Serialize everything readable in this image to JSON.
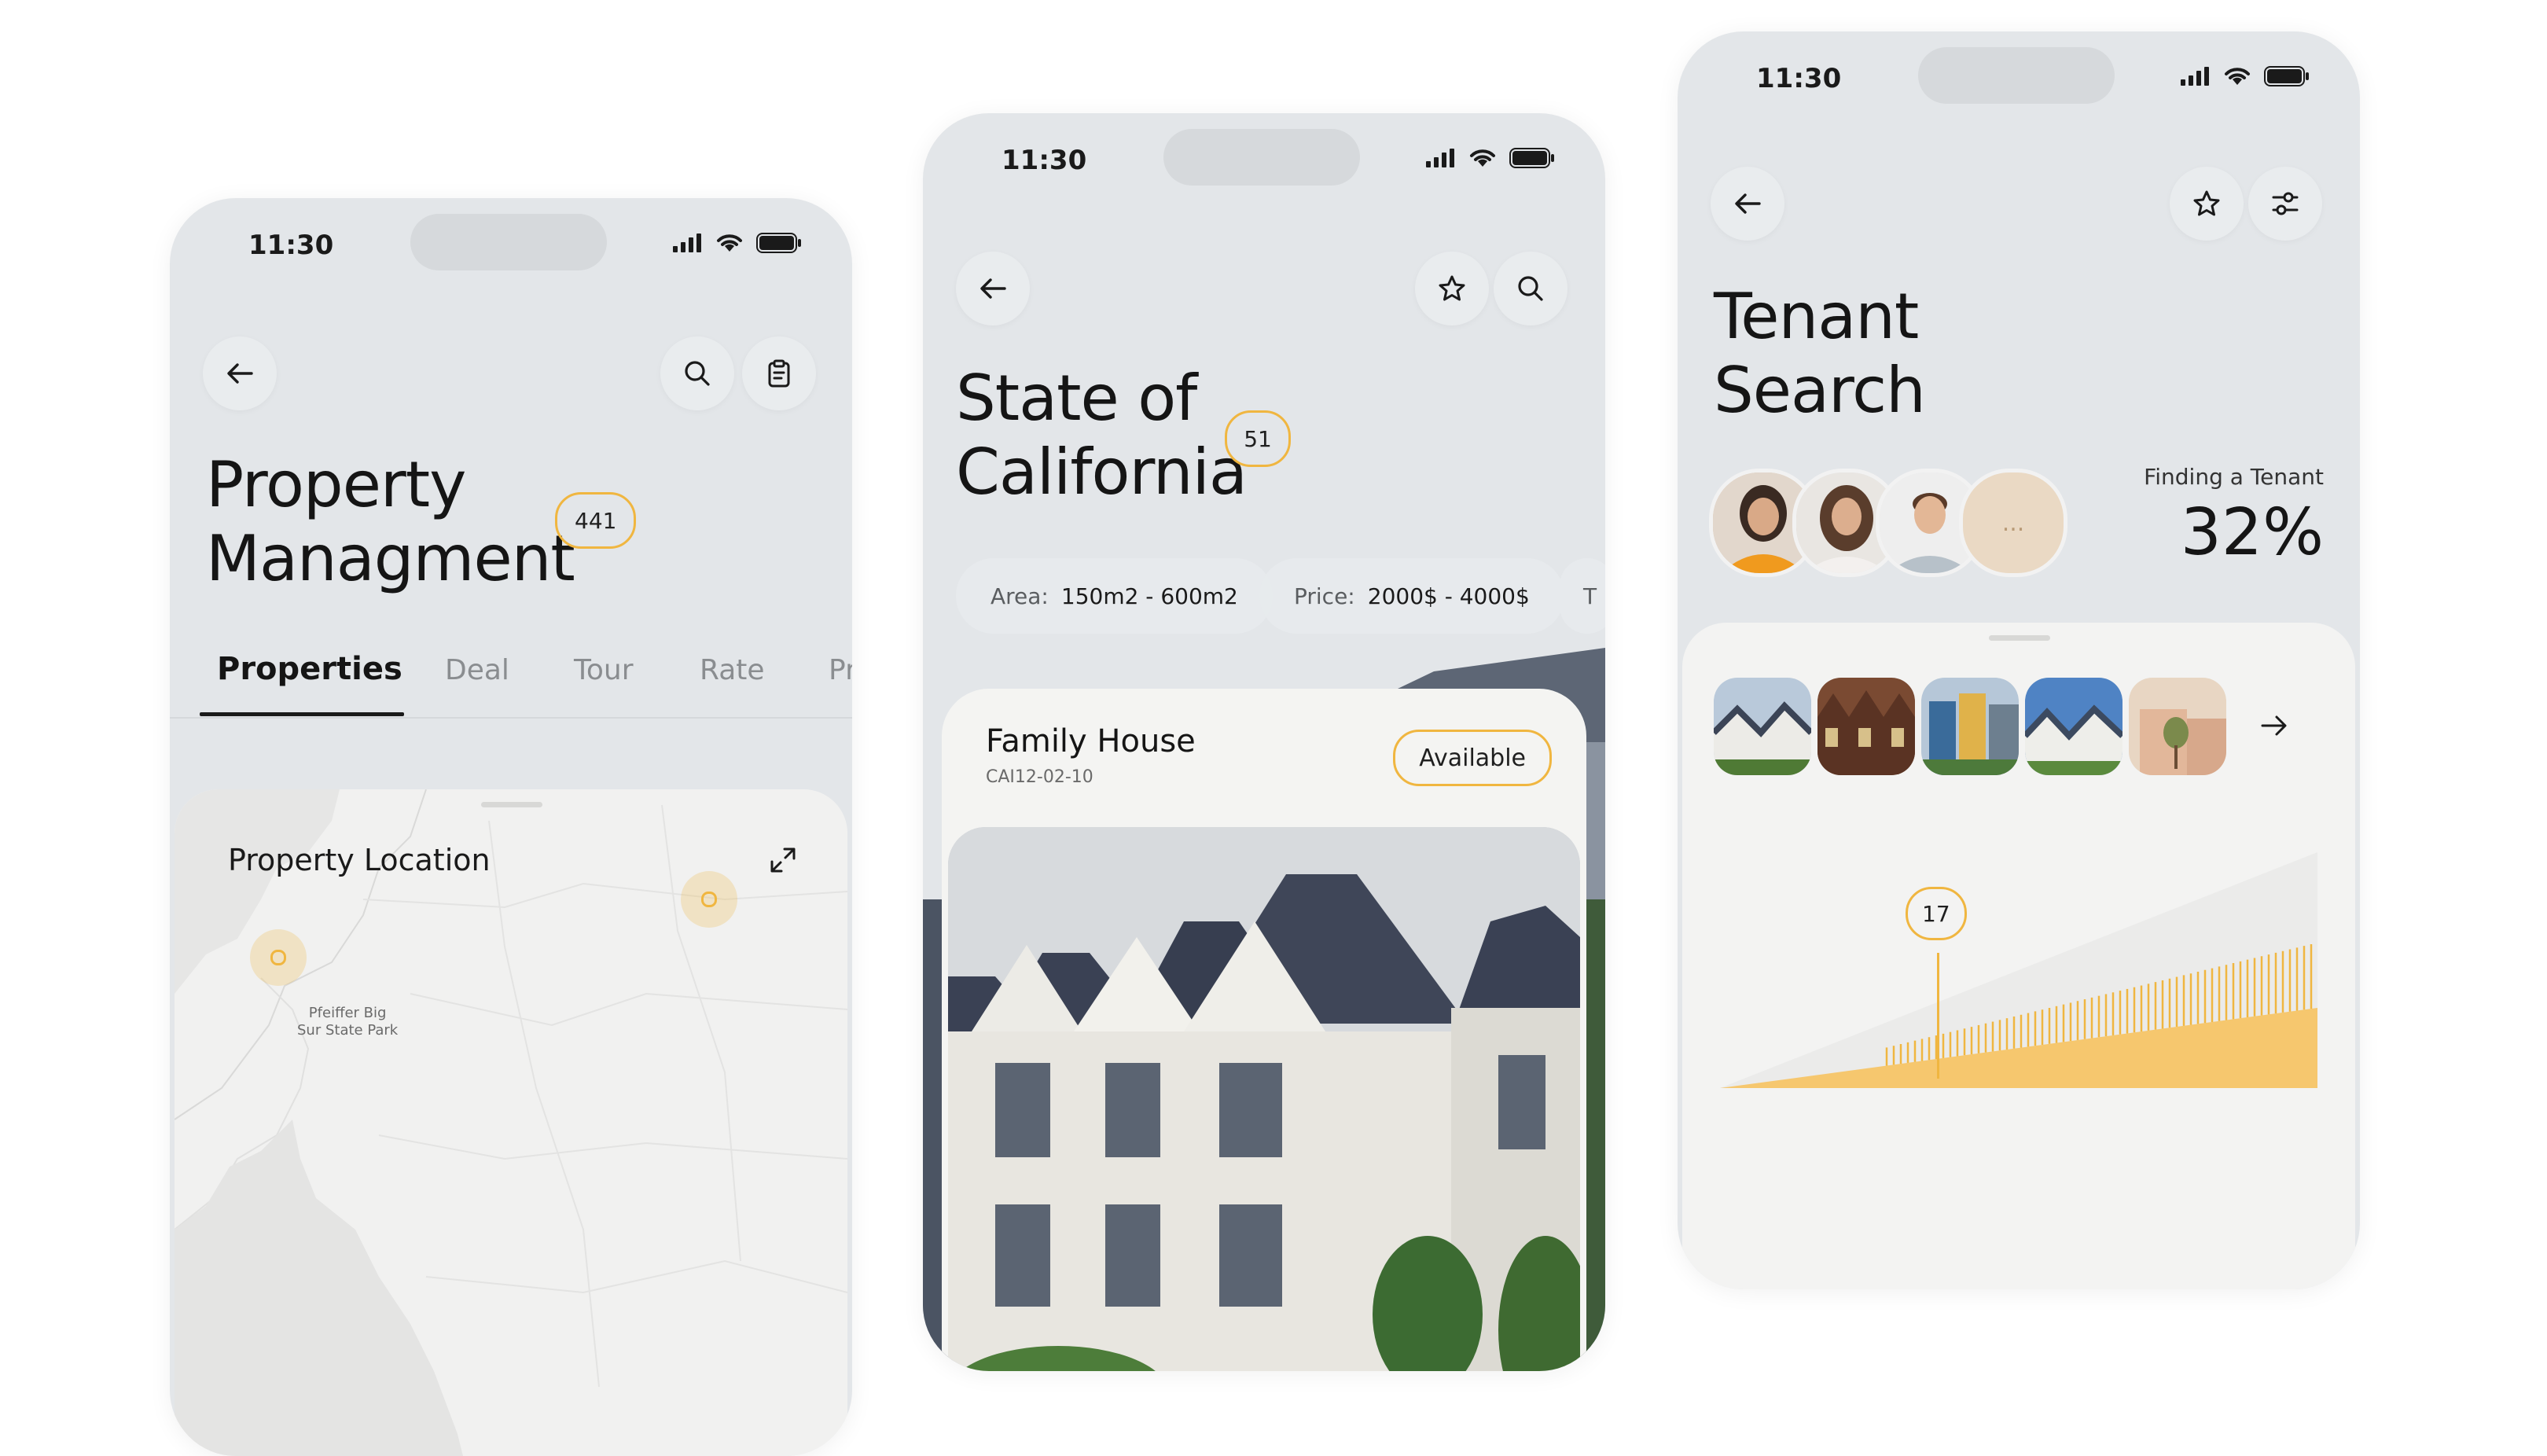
{
  "colors": {
    "accent": "#f0b640",
    "background": "#e3e6e9",
    "sheet": "#f3f3f2"
  },
  "status": {
    "time": "11:30"
  },
  "phone1": {
    "title_line1": "Property",
    "title_line2": "Managment",
    "count": "441",
    "tabs": [
      "Properties",
      "Deal",
      "Tour",
      "Rate",
      "Pr"
    ],
    "active_tab": "Properties",
    "map": {
      "title": "Property Location",
      "place_label_line1": "Pfeiffer Big",
      "place_label_line2": "Sur State Park"
    }
  },
  "phone2": {
    "title_line1": "State of",
    "title_line2": "California",
    "count": "51",
    "filters": [
      {
        "label": "Area:",
        "value": "150m2 - 600m2"
      },
      {
        "label": "Price:",
        "value": "2000$ - 4000$"
      },
      {
        "label": "T",
        "value": ""
      }
    ],
    "card": {
      "title": "Family House",
      "code": "CAI12-02-10",
      "status": "Available"
    }
  },
  "phone3": {
    "title_line1": "Tenant",
    "title_line2": "Search",
    "finding_label": "Finding a Tenant",
    "finding_value": "32%",
    "more_avatars": "...",
    "chart_marker": "17"
  }
}
